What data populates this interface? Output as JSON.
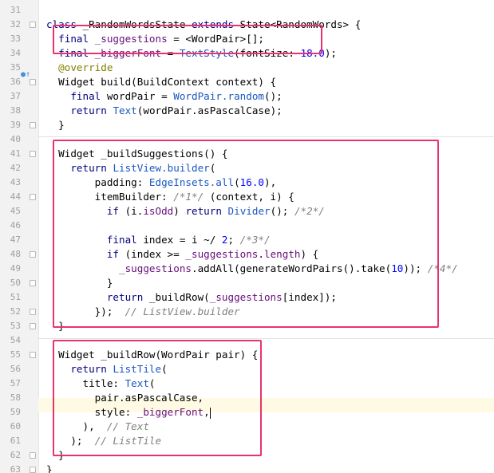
{
  "editor": {
    "lines": [
      {
        "num": "31",
        "html": ""
      },
      {
        "num": "32",
        "html": "<span class=\"kw\">class</span> _RandomWordsState <span class=\"kw\">extends</span> State&lt;RandomWords&gt; {"
      },
      {
        "num": "33",
        "html": "  <span class=\"kw\">final</span> <span class=\"fld\">_suggestions</span> = &lt;WordPair&gt;[];"
      },
      {
        "num": "34",
        "html": "  <span class=\"kw\">final</span> <span class=\"fld\">_biggerFont</span> = <span class=\"api\">TextStyle</span>(fontSize: <span class=\"num\">18.0</span>);"
      },
      {
        "num": "35",
        "html": "  <span class=\"ann\">@override</span>"
      },
      {
        "num": "36",
        "html": "  Widget build(BuildContext context) {"
      },
      {
        "num": "37",
        "html": "    <span class=\"kw\">final</span> wordPair = <span class=\"api\">WordPair.random</span>();"
      },
      {
        "num": "38",
        "html": "    <span class=\"kw\">return</span> <span class=\"api\">Text</span>(wordPair.asPascalCase);"
      },
      {
        "num": "39",
        "html": "  }"
      },
      {
        "num": "40",
        "html": ""
      },
      {
        "num": "41",
        "html": "  Widget _buildSuggestions() {"
      },
      {
        "num": "42",
        "html": "    <span class=\"kw\">return</span> <span class=\"api\">ListView.builder</span>("
      },
      {
        "num": "43",
        "html": "        padding: <span class=\"api\">EdgeInsets.all</span>(<span class=\"num\">16.0</span>),"
      },
      {
        "num": "44",
        "html": "        itemBuilder: <span class=\"cmt\">/*1*/</span> (context, i) {"
      },
      {
        "num": "45",
        "html": "          <span class=\"kw\">if</span> (i.<span class=\"fld\">isOdd</span>) <span class=\"kw\">return</span> <span class=\"api\">Divider</span>(); <span class=\"cmt\">/*2*/</span>"
      },
      {
        "num": "46",
        "html": ""
      },
      {
        "num": "47",
        "html": "          <span class=\"kw\">final</span> index = i ~/ <span class=\"num\">2</span>; <span class=\"cmt\">/*3*/</span>"
      },
      {
        "num": "48",
        "html": "          <span class=\"kw\">if</span> (index &gt;= <span class=\"fld\">_suggestions</span>.<span class=\"fld\">length</span>) {"
      },
      {
        "num": "49",
        "html": "            <span class=\"fld\">_suggestions</span>.addAll(generateWordPairs().take(<span class=\"num\">10</span>)); <span class=\"cmt\">/*4*/</span>"
      },
      {
        "num": "50",
        "html": "          }"
      },
      {
        "num": "51",
        "html": "          <span class=\"kw\">return</span> _buildRow(<span class=\"fld\">_suggestions</span>[index]);"
      },
      {
        "num": "52",
        "html": "        });  <span class=\"cmt\">// ListView.builder</span>"
      },
      {
        "num": "53",
        "html": "  }"
      },
      {
        "num": "54",
        "html": ""
      },
      {
        "num": "55",
        "html": "  Widget _buildRow(WordPair pair) {"
      },
      {
        "num": "56",
        "html": "    <span class=\"kw\">return</span> <span class=\"api\">ListTile</span>("
      },
      {
        "num": "57",
        "html": "      title: <span class=\"api\">Text</span>("
      },
      {
        "num": "58",
        "html": "        pair.asPascalCase,"
      },
      {
        "num": "59",
        "html": "        style: <span class=\"fld\">_biggerFont</span>,<span class=\"caret\"></span>"
      },
      {
        "num": "60",
        "html": "      ),  <span class=\"cmt\">// Text</span>"
      },
      {
        "num": "61",
        "html": "    );  <span class=\"cmt\">// ListTile</span>"
      },
      {
        "num": "62",
        "html": "  }"
      },
      {
        "num": "63",
        "html": "}"
      }
    ]
  }
}
